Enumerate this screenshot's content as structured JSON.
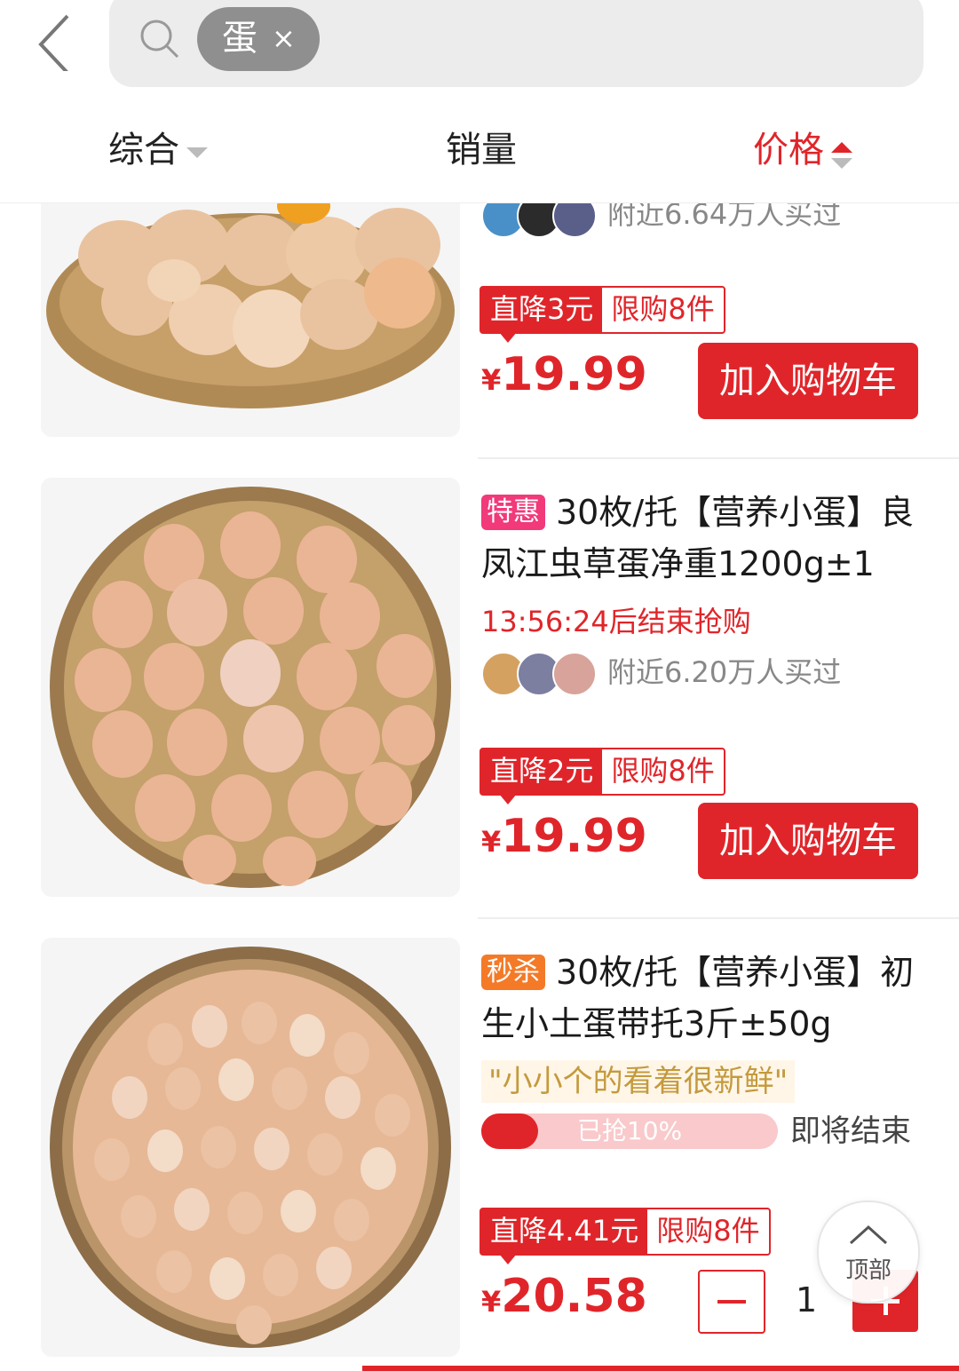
{
  "search": {
    "keyword": "蛋",
    "clear": "×"
  },
  "sort": {
    "comprehensive": "综合",
    "sales": "销量",
    "price": "价格"
  },
  "products": [
    {
      "buyers": "附近6.64万人买过",
      "promo_drop": "直降3元",
      "promo_limit": "限购8件",
      "currency": "¥",
      "price": "19.99",
      "cart": "加入购物车"
    },
    {
      "tag": "特惠",
      "title": "30枚/托【营养小蛋】良凤江虫草蛋净重1200g±1",
      "countdown": "13:56:24后结束抢购",
      "buyers": "附近6.20万人买过",
      "promo_drop": "直降2元",
      "promo_limit": "限购8件",
      "currency": "¥",
      "price": "19.99",
      "cart": "加入购物车"
    },
    {
      "tag": "秒杀",
      "title": "30枚/托【营养小蛋】初生小土蛋带托3斤±50g",
      "quote": "\"小小个的看着很新鲜\"",
      "progress_label": "已抢10%",
      "progress_value": 0.1,
      "ending": "即将结束",
      "promo_drop": "直降4.41元",
      "promo_limit": "限购8件",
      "currency": "¥",
      "price": "20.58",
      "qty": "1"
    }
  ],
  "totop": "顶部",
  "colors": {
    "accent": "#e0252a",
    "tag_th": "#f2397a",
    "tag_ms": "#f47a28"
  }
}
